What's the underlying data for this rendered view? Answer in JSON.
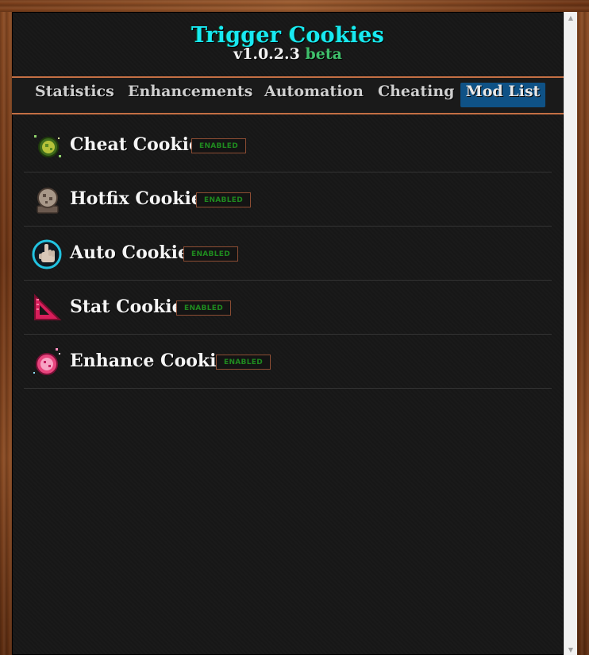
{
  "header": {
    "title": "Trigger Cookies",
    "version": "v1.0.2.3",
    "channel": "beta"
  },
  "nav": {
    "tabs": [
      {
        "label": "Statistics",
        "active": false
      },
      {
        "label": "Enhancements",
        "active": false
      },
      {
        "label": "Automation",
        "active": false
      },
      {
        "label": "Cheating",
        "active": false
      },
      {
        "label": "Mod List",
        "active": true
      }
    ]
  },
  "mods": [
    {
      "name": "Cheat Cookie",
      "status": "ENABLED",
      "icon": "sparkle-cookie-icon"
    },
    {
      "name": "Hotfix Cookie",
      "status": "ENABLED",
      "icon": "stone-cookie-icon"
    },
    {
      "name": "Auto Cookie",
      "status": "ENABLED",
      "icon": "cursor-hand-icon"
    },
    {
      "name": "Stat Cookie",
      "status": "ENABLED",
      "icon": "triangle-ruler-icon"
    },
    {
      "name": "Enhance Cookie",
      "status": "ENABLED",
      "icon": "sparkle-gem-icon"
    }
  ],
  "colors": {
    "title": "#19e8f2",
    "beta": "#3fbf6b",
    "active_tab": "#0f5286",
    "badge_text": "#1f8a1f",
    "frame": "#7a3f1b"
  }
}
